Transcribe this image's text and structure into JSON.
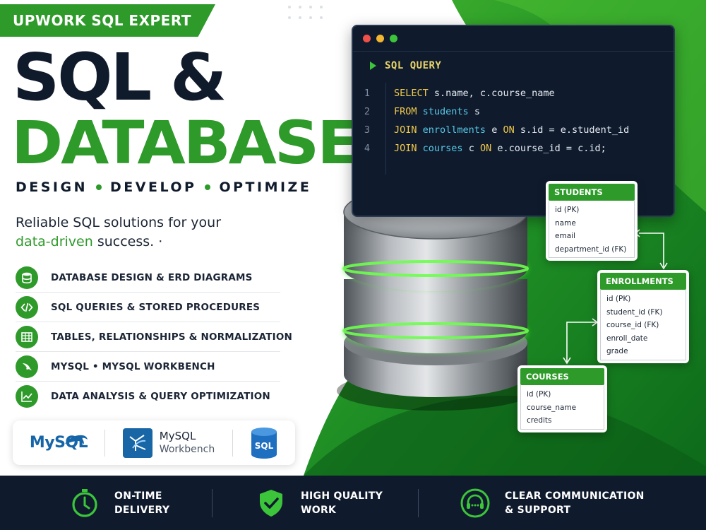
{
  "badge": {
    "label": "UPWORK SQL EXPERT"
  },
  "headline": {
    "line1": "SQL &",
    "line2": "DATABASE"
  },
  "tagline": {
    "items": [
      "DESIGN",
      "DEVELOP",
      "OPTIMIZE"
    ]
  },
  "subtitle": {
    "part1": "Reliable SQL solutions for your",
    "highlight": "data-driven",
    "part2": " success. ·"
  },
  "features": [
    {
      "icon": "database-icon",
      "label": "DATABASE DESIGN & ERD DIAGRAMS"
    },
    {
      "icon": "code-icon",
      "label": "SQL QUERIES & STORED PROCEDURES"
    },
    {
      "icon": "table-icon",
      "label": "TABLES, RELATIONSHIPS & NORMALIZATION"
    },
    {
      "icon": "dolphin-icon",
      "label": "MYSQL • MYSQL WORKBENCH"
    },
    {
      "icon": "chart-icon",
      "label": "DATA ANALYSIS & QUERY OPTIMIZATION"
    }
  ],
  "logos": {
    "mysql_text": "MySQL",
    "workbench_line1": "MySQL",
    "workbench_line2": "Workbench",
    "sql_badge": "SQL"
  },
  "code": {
    "header": "SQL QUERY",
    "lines": [
      {
        "num": "1",
        "tokens": [
          [
            "kw",
            "SELECT"
          ],
          [
            "plain",
            " s.name, c.course_name"
          ]
        ]
      },
      {
        "num": "2",
        "tokens": [
          [
            "kw",
            "FROM"
          ],
          [
            "plain",
            " "
          ],
          [
            "tbl",
            "students"
          ],
          [
            "plain",
            " s"
          ]
        ]
      },
      {
        "num": "3",
        "tokens": [
          [
            "kw",
            "JOIN"
          ],
          [
            "plain",
            " "
          ],
          [
            "tbl",
            "enrollments"
          ],
          [
            "plain",
            " e "
          ],
          [
            "kw",
            "ON"
          ],
          [
            "plain",
            " s.id = e.student_id"
          ]
        ]
      },
      {
        "num": "4",
        "tokens": [
          [
            "kw",
            "JOIN"
          ],
          [
            "plain",
            " "
          ],
          [
            "tbl",
            "courses"
          ],
          [
            "plain",
            " c "
          ],
          [
            "kw",
            "ON"
          ],
          [
            "plain",
            " e.course_id = c.id;"
          ]
        ]
      }
    ]
  },
  "entities": {
    "students": {
      "title": "STUDENTS",
      "fields": [
        "id (PK)",
        "name",
        "email",
        "department_id (FK)"
      ]
    },
    "enrollments": {
      "title": "ENROLLMENTS",
      "fields": [
        "id (PK)",
        "student_id (FK)",
        "course_id (FK)",
        "enroll_date",
        "grade"
      ]
    },
    "courses": {
      "title": "COURSES",
      "fields": [
        "id (PK)",
        "course_name",
        "credits"
      ]
    }
  },
  "perks": [
    {
      "icon": "stopwatch-icon",
      "line1": "ON-TIME",
      "line2": "DELIVERY"
    },
    {
      "icon": "shield-check-icon",
      "line1": "HIGH QUALITY",
      "line2": "WORK"
    },
    {
      "icon": "headset-icon",
      "line1": "CLEAR COMMUNICATION",
      "line2": "& SUPPORT"
    }
  ],
  "colors": {
    "brand_green": "#2e9a2a",
    "navy": "#0f1b2d",
    "keyword_yellow": "#f1c94b",
    "table_cyan": "#57c8e8",
    "mysql_blue": "#1565a8",
    "mysql_orange": "#e38b10"
  }
}
